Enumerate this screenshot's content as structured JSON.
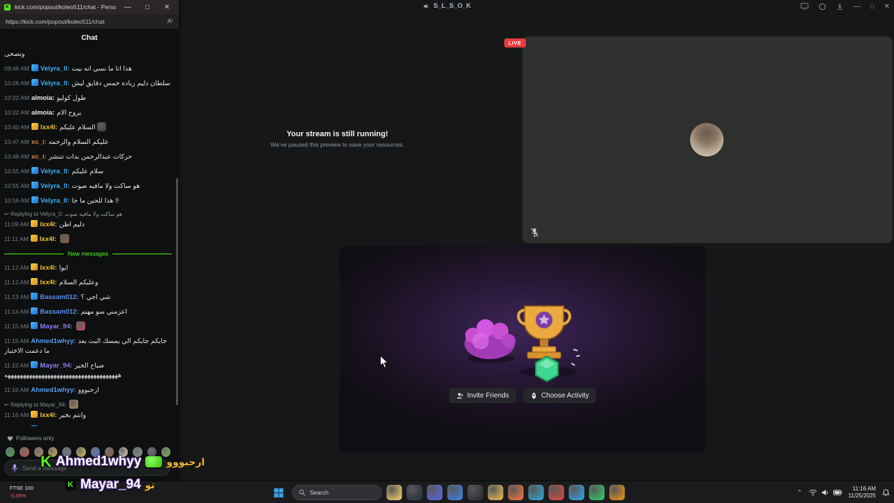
{
  "browser": {
    "title": "kick.com/popout/koleo511/chat - Perso...",
    "url": "https://kick.com/popout/koleo511/chat",
    "chat_label": "Chat",
    "new_messages_label": "New messages",
    "followers_label": "Followers only",
    "input_placeholder": "Send a message",
    "messages": [
      {
        "type": "partial",
        "text": "وتصحى"
      },
      {
        "type": "msg",
        "time": "09:46 AM",
        "user": "Velyra_0",
        "user_color": "#3db2f5",
        "badge": "blue",
        "text": "هذا انا ما نسي انه بيت"
      },
      {
        "type": "msg",
        "time": "10:06 AM",
        "user": "Velyra_0",
        "user_color": "#3db2f5",
        "badge": "blue",
        "text": "سلطان دليم زياده خمس دقايق ليش"
      },
      {
        "type": "msg",
        "time": "10:22 AM",
        "user": "almoia",
        "user_color": "#ededed",
        "badge": null,
        "text": "طول كوليو"
      },
      {
        "type": "msg",
        "time": "10:22 AM",
        "user": "almoia",
        "user_color": "#ededed",
        "badge": null,
        "text": "يروح الام"
      },
      {
        "type": "msg",
        "time": "10:40 AM",
        "user": "lxx4l",
        "user_color": "#f3c131",
        "badge": "gold",
        "text": "السلام عليكم",
        "emote": "#4a3b2e"
      },
      {
        "type": "msg",
        "time": "10:47 AM",
        "user": "xc_i",
        "user_color": "#e2813f",
        "badge": null,
        "text": "عليكم السلام والرحمه"
      },
      {
        "type": "msg",
        "time": "10:48 AM",
        "user": "xc_i",
        "user_color": "#e2813f",
        "badge": null,
        "text": "حركات عبدالرحمن بدات تتنشر"
      },
      {
        "type": "msg",
        "time": "10:55 AM",
        "user": "Velyra_0",
        "user_color": "#3db2f5",
        "badge": "blue",
        "text": "سلام عليكم"
      },
      {
        "type": "msg",
        "time": "10:55 AM",
        "user": "Velyra_0",
        "user_color": "#3db2f5",
        "badge": "blue",
        "text": "هو ساكت ولا مافيه صوت"
      },
      {
        "type": "msg",
        "time": "10:56 AM",
        "user": "Velyra_0",
        "user_color": "#3db2f5",
        "badge": "blue",
        "text": "!! هذا للحين ما جا"
      },
      {
        "type": "msg",
        "time": "11:09 AM",
        "user": "lxx4l",
        "user_color": "#f3c131",
        "badge": "gold",
        "text": "دليم اظن",
        "reply_to": "Velyra_0",
        "reply_text": "هو ساكت ولا مافيه صوت"
      },
      {
        "type": "msg",
        "time": "11:11 AM",
        "user": "lxx4l",
        "user_color": "#f3c131",
        "badge": "gold",
        "text": "",
        "emote": "#8a5a3a"
      },
      {
        "type": "divider"
      },
      {
        "type": "msg",
        "time": "11:12 AM",
        "user": "lxx4l",
        "user_color": "#f3c131",
        "badge": "gold",
        "text": "ايوا"
      },
      {
        "type": "msg",
        "time": "11:12 AM",
        "user": "lxx4l",
        "user_color": "#f3c131",
        "badge": "gold",
        "text": "وعليكم السلام"
      },
      {
        "type": "msg",
        "time": "11:13 AM",
        "user": "Bassam012",
        "user_color": "#5b8df0",
        "badge": "blue",
        "text": "شي اجي ؟"
      },
      {
        "type": "msg",
        "time": "11:14 AM",
        "user": "Bassam012",
        "user_color": "#5b8df0",
        "badge": "blue",
        "text": "اعزمني سو مهتم"
      },
      {
        "type": "msg",
        "time": "11:15 AM",
        "user": "Mayar_94",
        "user_color": "#8f7df2",
        "badge": "blue",
        "text": "",
        "emote": "#c24a5a"
      },
      {
        "type": "msg",
        "time": "11:15 AM",
        "user": "Ahmed1whyy",
        "user_color": "#5b9df0",
        "badge": null,
        "text": "جايكم جايكم الي يمسك البث بعد ما دعمت الاختبار"
      },
      {
        "type": "msg",
        "time": "11:15 AM",
        "user": "Mayar_94",
        "user_color": "#8f7df2",
        "badge": "blue",
        "text": "صباح الخير هههههههههههههههههههههههههههههههههههههه"
      },
      {
        "type": "msg",
        "time": "11:16 AM",
        "user": "Ahmed1whyy",
        "user_color": "#5b9df0",
        "badge": null,
        "text": "ارحبووو"
      },
      {
        "type": "msg",
        "time": "11:16 AM",
        "user": "lxx4l",
        "user_color": "#f3c131",
        "badge": "gold",
        "text": "وانتم بخير",
        "reply_to": "Mayar_94",
        "reply_text": "",
        "reply_emote": "#b9855a"
      },
      {
        "type": "msg",
        "time": "11:16 AM",
        "user": "Mayar_94",
        "user_color": "#8f7df2",
        "badge": "blue",
        "text": "تو"
      }
    ],
    "emote_row": [
      {
        "name": "emote-green",
        "color": "#3fae4a"
      },
      {
        "name": "emote-red",
        "color": "#c2503d"
      },
      {
        "name": "emote-tan",
        "color": "#b98b5a"
      },
      {
        "name": "emote-gold",
        "color": "#e0b03a"
      },
      {
        "name": "emote-steel",
        "color": "#6a7f8a"
      },
      {
        "name": "emote-yellow",
        "color": "#d8c23a"
      },
      {
        "name": "emote-blue",
        "color": "#4a7fd9"
      },
      {
        "name": "emote-brown",
        "color": "#8a5a3a"
      },
      {
        "name": "emote-light",
        "color": "#d9d4c8"
      },
      {
        "name": "emote-gray",
        "color": "#8a8f93"
      },
      {
        "name": "emote-dark",
        "color": "#4a4f52"
      },
      {
        "name": "emote-lime",
        "color": "#7ac23d"
      }
    ]
  },
  "discord": {
    "title": "S_L_S_O_K",
    "live": "LIVE",
    "stream_title": "Your stream is still running!",
    "stream_sub": "We've paused this preview to save your resources.",
    "invite": "Invite Friends",
    "choose": "Choose Activity"
  },
  "overlays": {
    "alert1": {
      "user": "Ahmed1whyy",
      "message": "ارحبووو"
    },
    "alert2": {
      "user": "Mayar_94",
      "message": "تو"
    }
  },
  "taskbar": {
    "widget": {
      "title": "FTSE 100",
      "change": "-0,05%"
    },
    "search": "Search",
    "time": "11:16 AM",
    "date": "11/25/2025",
    "apps": [
      {
        "name": "file-explorer",
        "color": "#ffd76e"
      },
      {
        "name": "steam",
        "color": "#1b2838"
      },
      {
        "name": "discord",
        "color": "#5865f2"
      },
      {
        "name": "photos",
        "color": "#3b82f6"
      },
      {
        "name": "obs",
        "color": "#23252b"
      },
      {
        "name": "folder",
        "color": "#f2c14e"
      },
      {
        "name": "firefox",
        "color": "#ff7139"
      },
      {
        "name": "edge",
        "color": "#2ea9e0"
      },
      {
        "name": "app-red",
        "color": "#e0483e"
      },
      {
        "name": "telegram",
        "color": "#2aabee"
      },
      {
        "name": "whatsapp",
        "color": "#25d366"
      },
      {
        "name": "prime-video",
        "color": "#f2960e"
      }
    ]
  },
  "accent_colors": {
    "kick_green": "#53fc18",
    "live_red": "#ea3a3f"
  }
}
